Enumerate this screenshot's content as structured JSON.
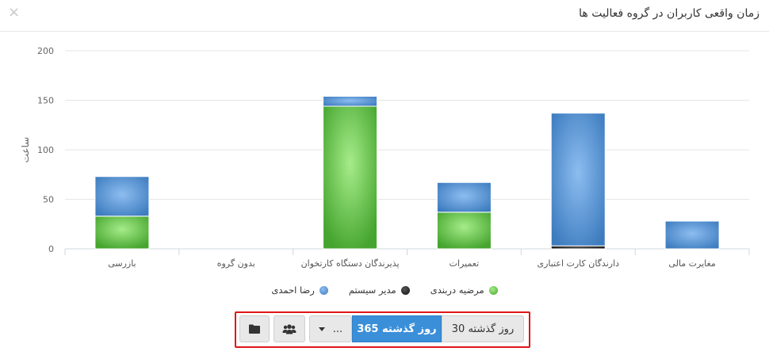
{
  "header": {
    "title": "زمان واقعی کاربران در گروه فعالیت ها",
    "close_glyph": "×"
  },
  "chart_data": {
    "type": "bar",
    "stacked": true,
    "ylabel": "ساعت",
    "ylim": [
      0,
      200
    ],
    "yticks": [
      0,
      50,
      100,
      150,
      200
    ],
    "grid": true,
    "legend_position": "bottom",
    "categories": [
      "بازرسی",
      "بدون گروه",
      "پذیرندگان دستگاه کارتخوان",
      "تعمیرات",
      "دارندگان کارت اعتباری",
      "مغایرت مالی"
    ],
    "series": [
      {
        "name": "مرضیه دربندی",
        "color": "#5cbf3f",
        "values": [
          33,
          0,
          144,
          37,
          0,
          0
        ]
      },
      {
        "name": "مدیر سیستم",
        "color": "#222222",
        "values": [
          0,
          0,
          0,
          0,
          3,
          0
        ]
      },
      {
        "name": "رضا احمدی",
        "color": "#4f8fd0",
        "values": [
          40,
          0,
          10,
          30,
          134,
          28
        ]
      }
    ]
  },
  "toolbar": {
    "btn_30": "30 روز گذشته",
    "btn_365": "365 روز گذشته",
    "btn_more": "...",
    "active": "btn_365"
  },
  "colors": {
    "accent": "#3b8fd9",
    "highlight_frame": "#e01616"
  }
}
